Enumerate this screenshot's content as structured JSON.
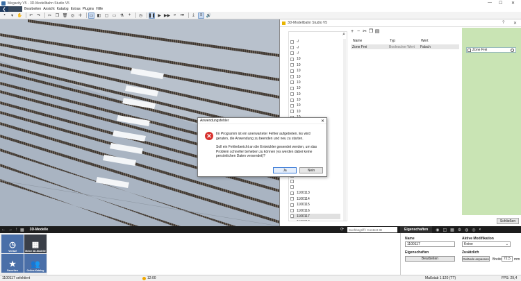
{
  "window": {
    "title": "Megacity V5 - 3D-Modellbahn Studio V5",
    "controls": [
      "—",
      "☐",
      "✕"
    ]
  },
  "menu": [
    "Bearbeiten",
    "Ansicht",
    "Katalog",
    "Extras",
    "Plugins",
    "Hilfe"
  ],
  "toolbar": {
    "icons": [
      "save-icon",
      "save-as-icon",
      "hand-icon",
      "undo-icon",
      "redo-icon",
      "cut-icon",
      "copy-icon",
      "delete-icon",
      "view-2d-icon",
      "view-3d-icon",
      "camera-icon",
      "move-icon",
      "sep",
      "clock-icon",
      "sep",
      "pause-icon",
      "play-icon",
      "fast-forward-icon",
      "faster-icon",
      "skip-icon",
      "sep",
      "download-icon",
      "layers-icon",
      "sound-icon"
    ]
  },
  "side_window": {
    "title": "3D-Modellbahn Studio V5",
    "controls": [
      "?",
      "✕"
    ],
    "tree_items": [
      "-/",
      "-/",
      "-/",
      "10",
      "10",
      "10",
      "10",
      "10",
      "10",
      "10",
      "10",
      "10",
      "10",
      "10",
      "1100101",
      "",
      "",
      "",
      "",
      "",
      "",
      "",
      "",
      "",
      "",
      "",
      "1100113",
      "1100114",
      "1100115",
      "1100116",
      "1100117",
      "1100118"
    ],
    "tree_selected": "1100117",
    "prop_headers": {
      "name": "Name",
      "type": "Typ",
      "value": "Wert"
    },
    "prop_row": {
      "name": "Zone Frei",
      "type": "Boolescher Wert",
      "value": "Falsch"
    },
    "green_checkbox_label": "Zone Frei",
    "close_label": "Schließen"
  },
  "error_dialog": {
    "title": "Anwendungsfehler",
    "message1": "Im Programm ist ein unerwarteter Fehler aufgetreten. Es wird geraten, die Anwendung zu beenden und neu zu starten.",
    "message2": "Soll ein Fehlerbericht an die Entwickler gesendet werden, um das Problem schneller beheben zu können (es werden dabei keine persönlichen Daten versendet)?",
    "yes_label": "Ja",
    "no_label": "Nein"
  },
  "bottom_panel": {
    "title": "3D-Modelle",
    "search_placeholder": "Suchbegriff / Content-ID",
    "tab_label": "Eigenschaften",
    "categories": [
      {
        "label": "Verlauf",
        "icon": "clock-icon"
      },
      {
        "label": "Meine 3D-Modelle",
        "icon": "grid-icon"
      },
      {
        "label": "Favoriten",
        "icon": "star-icon"
      },
      {
        "label": "Online-Katalog",
        "icon": "people-icon"
      }
    ],
    "props": {
      "name_label": "Name",
      "name_value": "1100117",
      "eigenschaften_label": "Eigenschaften",
      "bearbeiten_label": "Bearbeiten",
      "aktive_label": "Aktive Modifikation",
      "aktive_value": "Keine",
      "zusaetzlich_label": "Zusätzlich",
      "gelaende_label": "Gelände anpassen",
      "breite_label": "Breite:",
      "breite_value": "72,5",
      "unit": "mm"
    }
  },
  "status_bar": {
    "selection": "1100117 selektiert",
    "time": "12:00",
    "scale": "Maßstab 1:120 (TT)",
    "fps": "FPS: 29,4"
  }
}
